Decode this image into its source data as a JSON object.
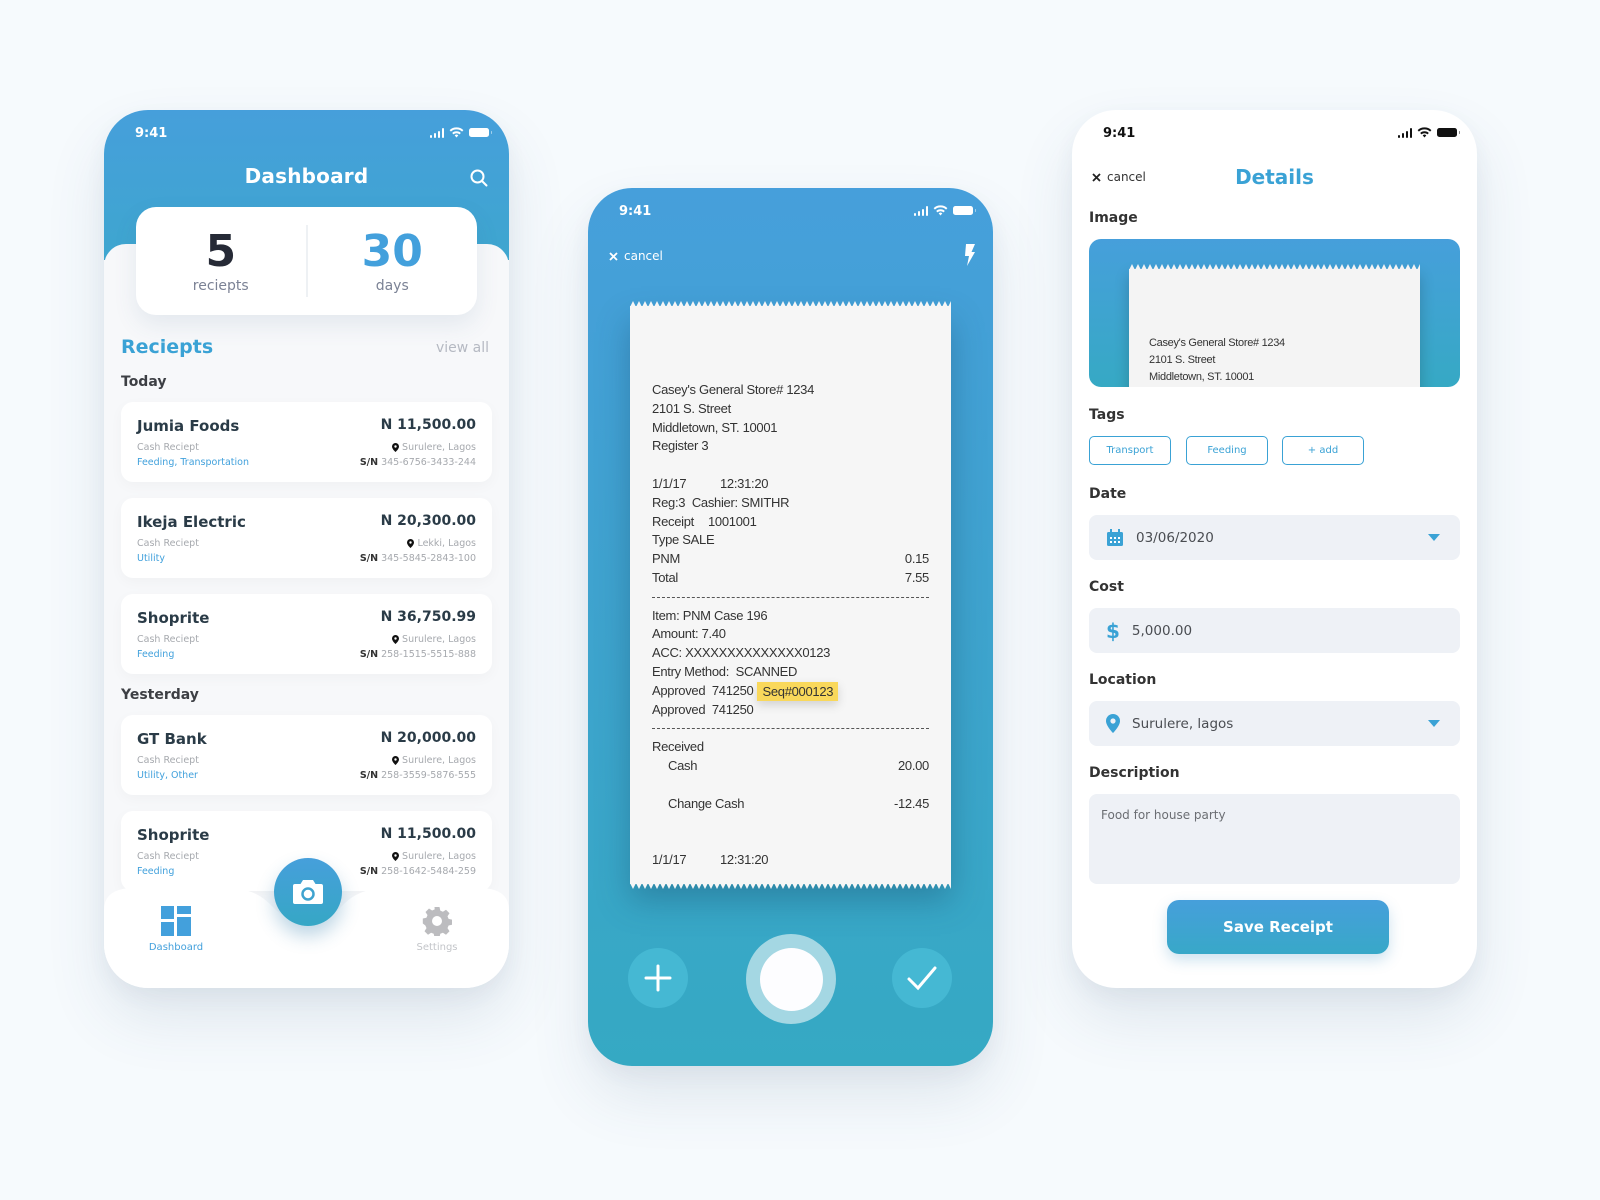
{
  "status_bar": {
    "time": "9:41"
  },
  "dashboard": {
    "title": "Dashboard",
    "stats": [
      {
        "value": "5",
        "label": "reciepts"
      },
      {
        "value": "30",
        "label": "days"
      }
    ],
    "section_title": "Reciepts",
    "view_all": "view all",
    "groups": [
      {
        "label": "Today"
      },
      {
        "label": "Yesterday"
      }
    ],
    "receipts": [
      {
        "name": "Jumia Foods",
        "amount": "N 11,500.00",
        "type": "Cash Reciept",
        "tags": "Feeding, Transportation",
        "location": "Surulere, Lagos",
        "sn_label": "S/N",
        "sn": "345-6756-3433-244"
      },
      {
        "name": "Ikeja Electric",
        "amount": "N 20,300.00",
        "type": "Cash Reciept",
        "tags": "Utility",
        "location": "Lekki, Lagos",
        "sn_label": "S/N",
        "sn": "345-5845-2843-100"
      },
      {
        "name": "Shoprite",
        "amount": "N 36,750.99",
        "type": "Cash Reciept",
        "tags": "Feeding",
        "location": "Surulere, Lagos",
        "sn_label": "S/N",
        "sn": "258-1515-5515-888"
      },
      {
        "name": "GT Bank",
        "amount": "N 20,000.00",
        "type": "Cash Reciept",
        "tags": "Utility, Other",
        "location": "Surulere, Lagos",
        "sn_label": "S/N",
        "sn": "258-3559-5876-555"
      },
      {
        "name": "Shoprite",
        "amount": "N 11,500.00",
        "type": "Cash Reciept",
        "tags": "Feeding",
        "location": "Surulere, Lagos",
        "sn_label": "S/N",
        "sn": "258-1642-5484-259"
      }
    ],
    "nav": {
      "dashboard": "Dashboard",
      "settings": "Settings"
    }
  },
  "scanner": {
    "cancel": "cancel",
    "receipt": {
      "header": [
        "Casey's General Store# 1234",
        "2101 S. Street",
        "Middletown, ST. 10001",
        "Register 3"
      ],
      "date": "1/1/17",
      "time": "12:31:20",
      "reg_cashier": "Reg:3  Cashier: SMITHR",
      "receipt_label": "Receipt",
      "receipt_no": "1001001",
      "type": "Type SALE",
      "pnm_label": "PNM",
      "pnm_value": "0.15",
      "total_label": "Total",
      "total_value": "7.55",
      "item": "Item: PNM Case 196",
      "amount": "Amount: 7.40",
      "acc": "ACC: XXXXXXXXXXXXXX0123",
      "entry": "Entry Method:  SCANNED",
      "approved1": "Approved  741250",
      "seq": "Seq#000123",
      "approved2": "Approved  741250",
      "received": "Received",
      "cash_label": "Cash",
      "cash_value": "20.00",
      "change_label": "Change Cash",
      "change_value": "-12.45",
      "footer_date": "1/1/17",
      "footer_time": "12:31:20"
    }
  },
  "details": {
    "cancel": "cancel",
    "title": "Details",
    "image_label": "Image",
    "image_lines": [
      "Casey's General Store# 1234",
      "2101 S. Street",
      "Middletown, ST. 10001"
    ],
    "tags_label": "Tags",
    "tags": [
      "Transport",
      "Feeding",
      "+ add"
    ],
    "date_label": "Date",
    "date_value": "03/06/2020",
    "cost_label": "Cost",
    "cost_value": "5,000.00",
    "location_label": "Location",
    "location_value": "Surulere, lagos",
    "description_label": "Description",
    "description_value": "Food for house party",
    "save": "Save Receipt"
  },
  "colors": {
    "accent": "#43a0dc",
    "teal": "#36a9c4",
    "highlight": "#f9d85b",
    "background": "#f6fafd"
  }
}
